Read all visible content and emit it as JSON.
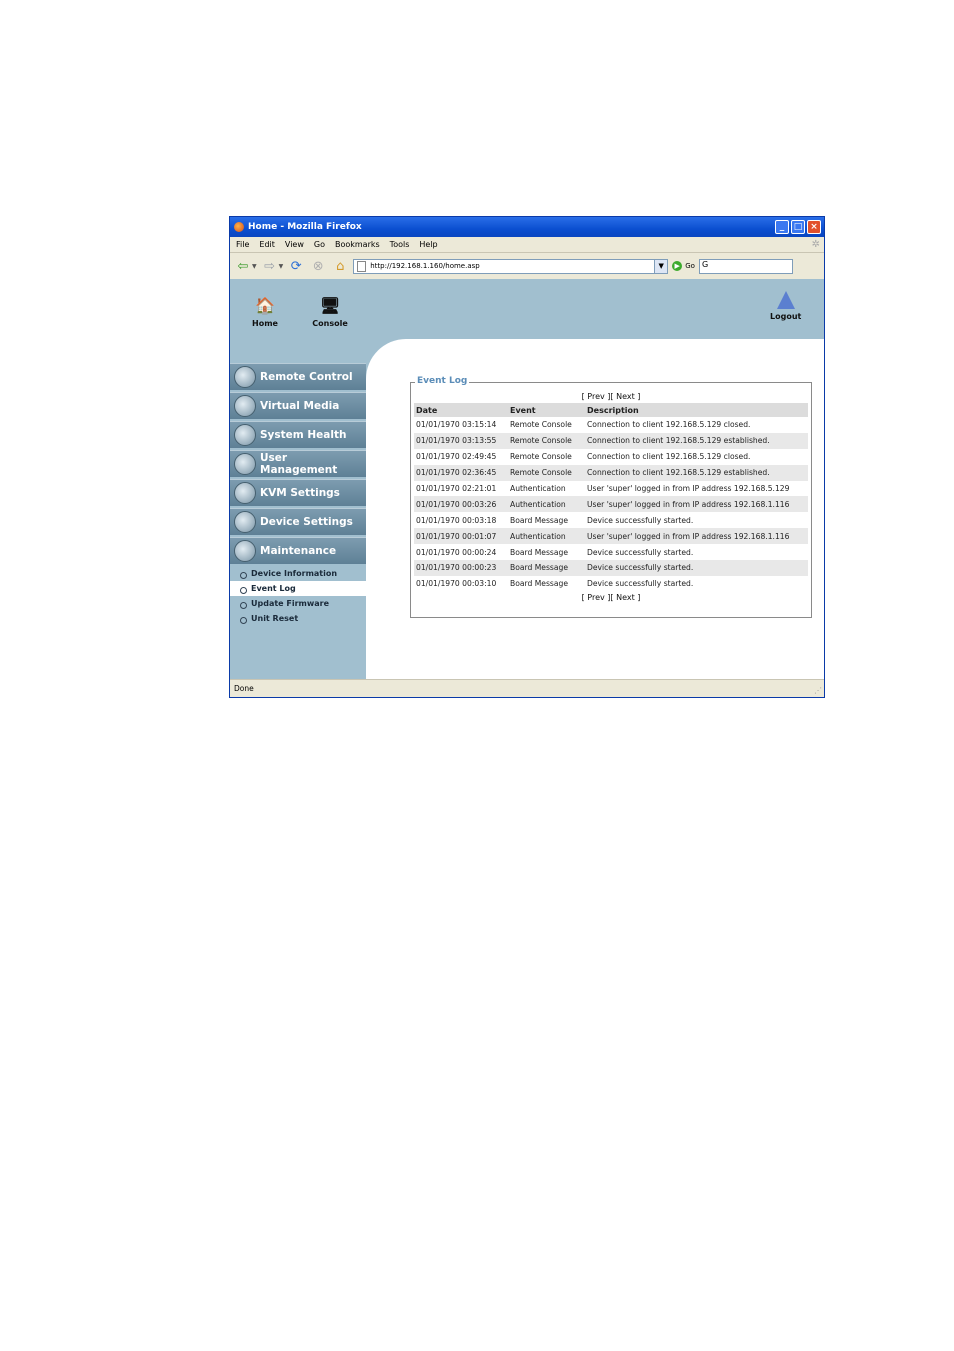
{
  "window": {
    "title": "Home - Mozilla Firefox",
    "controls": {
      "minimize": "_",
      "maximize": "□",
      "close": "×"
    }
  },
  "menubar": [
    "File",
    "Edit",
    "View",
    "Go",
    "Bookmarks",
    "Tools",
    "Help"
  ],
  "toolbar": {
    "url": "http://192.168.1.160/home.asp",
    "go_label": "Go",
    "search_value": "G"
  },
  "topnav": {
    "home_label": "Home",
    "console_label": "Console",
    "logout_label": "Logout"
  },
  "sidebar": {
    "sections": [
      {
        "label": "Remote Control"
      },
      {
        "label": "Virtual Media"
      },
      {
        "label": "System Health"
      },
      {
        "label": "User Management"
      },
      {
        "label": "KVM Settings"
      },
      {
        "label": "Device Settings"
      },
      {
        "label": "Maintenance"
      }
    ],
    "subitems": [
      {
        "label": "Device Information"
      },
      {
        "label": "Event Log"
      },
      {
        "label": "Update Firmware"
      },
      {
        "label": "Unit Reset"
      }
    ]
  },
  "event_log": {
    "legend": "Event Log",
    "pager": {
      "open": "[",
      "prev": "Prev",
      "mid": "][",
      "next": "Next",
      "close": "]"
    },
    "headers": {
      "date": "Date",
      "event": "Event",
      "description": "Description"
    },
    "rows": [
      {
        "date": "01/01/1970 03:15:14",
        "event": "Remote Console",
        "description": "Connection to client 192.168.5.129 closed."
      },
      {
        "date": "01/01/1970 03:13:55",
        "event": "Remote Console",
        "description": "Connection to client 192.168.5.129 established."
      },
      {
        "date": "01/01/1970 02:49:45",
        "event": "Remote Console",
        "description": "Connection to client 192.168.5.129 closed."
      },
      {
        "date": "01/01/1970 02:36:45",
        "event": "Remote Console",
        "description": "Connection to client 192.168.5.129 established."
      },
      {
        "date": "01/01/1970 02:21:01",
        "event": "Authentication",
        "description": "User 'super' logged in from IP address 192.168.5.129"
      },
      {
        "date": "01/01/1970 00:03:26",
        "event": "Authentication",
        "description": "User 'super' logged in from IP address 192.168.1.116"
      },
      {
        "date": "01/01/1970 00:03:18",
        "event": "Board Message",
        "description": "Device successfully started."
      },
      {
        "date": "01/01/1970 00:01:07",
        "event": "Authentication",
        "description": "User 'super' logged in from IP address 192.168.1.116"
      },
      {
        "date": "01/01/1970 00:00:24",
        "event": "Board Message",
        "description": "Device successfully started."
      },
      {
        "date": "01/01/1970 00:00:23",
        "event": "Board Message",
        "description": "Device successfully started."
      },
      {
        "date": "01/01/1970 00:03:10",
        "event": "Board Message",
        "description": "Device successfully started."
      }
    ]
  },
  "statusbar": {
    "text": "Done"
  },
  "colors": {
    "accent": "#5b8db8",
    "panel": "#a1bfcf",
    "titlebar": "#0b4fd0"
  }
}
